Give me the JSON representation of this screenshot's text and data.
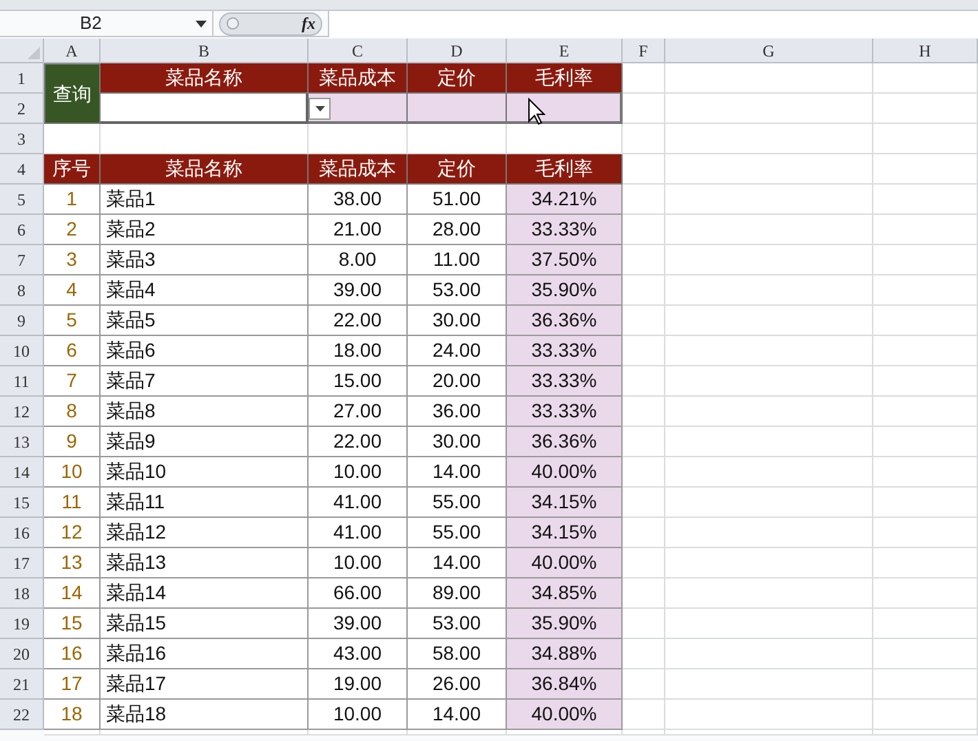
{
  "name_box": {
    "value": "B2"
  },
  "formula_bar": {
    "fx_label": "fx"
  },
  "columns": [
    "A",
    "B",
    "C",
    "D",
    "E",
    "F",
    "G",
    "H"
  ],
  "rows": [
    "1",
    "2",
    "3",
    "4",
    "5",
    "6",
    "7",
    "8",
    "9",
    "10",
    "11",
    "12",
    "13",
    "14",
    "15",
    "16",
    "17",
    "18",
    "19",
    "20",
    "21",
    "22"
  ],
  "query": {
    "label": "查询",
    "headers": [
      "菜品名称",
      "菜品成本",
      "定价",
      "毛利率"
    ]
  },
  "table": {
    "columns": [
      "序号",
      "菜品名称",
      "菜品成本",
      "定价",
      "毛利率"
    ],
    "rows": [
      [
        "1",
        "菜品1",
        "38.00",
        "51.00",
        "34.21%"
      ],
      [
        "2",
        "菜品2",
        "21.00",
        "28.00",
        "33.33%"
      ],
      [
        "3",
        "菜品3",
        "8.00",
        "11.00",
        "37.50%"
      ],
      [
        "4",
        "菜品4",
        "39.00",
        "53.00",
        "35.90%"
      ],
      [
        "5",
        "菜品5",
        "22.00",
        "30.00",
        "36.36%"
      ],
      [
        "6",
        "菜品6",
        "18.00",
        "24.00",
        "33.33%"
      ],
      [
        "7",
        "菜品7",
        "15.00",
        "20.00",
        "33.33%"
      ],
      [
        "8",
        "菜品8",
        "27.00",
        "36.00",
        "33.33%"
      ],
      [
        "9",
        "菜品9",
        "22.00",
        "30.00",
        "36.36%"
      ],
      [
        "10",
        "菜品10",
        "10.00",
        "14.00",
        "40.00%"
      ],
      [
        "11",
        "菜品11",
        "41.00",
        "55.00",
        "34.15%"
      ],
      [
        "12",
        "菜品12",
        "41.00",
        "55.00",
        "34.15%"
      ],
      [
        "13",
        "菜品13",
        "10.00",
        "14.00",
        "40.00%"
      ],
      [
        "14",
        "菜品14",
        "66.00",
        "89.00",
        "34.85%"
      ],
      [
        "15",
        "菜品15",
        "39.00",
        "53.00",
        "35.90%"
      ],
      [
        "16",
        "菜品16",
        "43.00",
        "58.00",
        "34.88%"
      ],
      [
        "17",
        "菜品17",
        "19.00",
        "26.00",
        "36.84%"
      ],
      [
        "18",
        "菜品18",
        "10.00",
        "14.00",
        "40.00%"
      ]
    ]
  }
}
